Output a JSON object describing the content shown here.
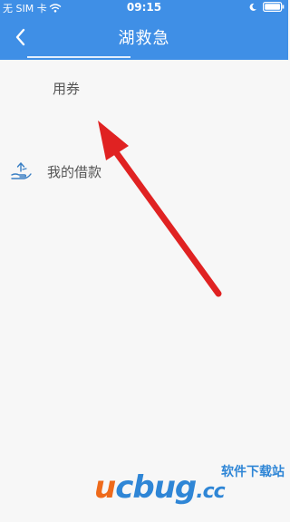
{
  "status_bar": {
    "carrier": "无 SIM 卡",
    "time": "09:15"
  },
  "nav": {
    "title": "湖救急"
  },
  "list": {
    "items": [
      {
        "label": "用券"
      },
      {
        "label": "我的借款"
      }
    ]
  },
  "watermark": {
    "cn_text": "软件下载站",
    "brand_u": "u",
    "brand_rest": "cbug",
    "brand_cc": ".cc"
  },
  "colors": {
    "header_bg": "#3f8fe6",
    "arrow": "#e02222",
    "watermark_blue": "#2f86d6",
    "watermark_orange": "#ee6a1b"
  }
}
